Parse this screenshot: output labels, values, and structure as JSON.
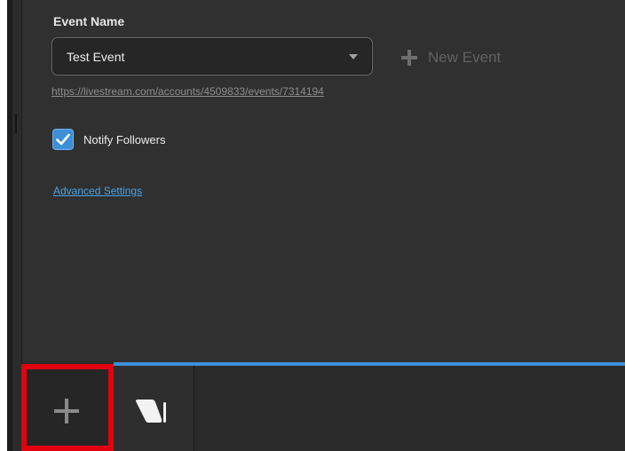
{
  "event": {
    "label": "Event Name",
    "selected_event": "Test Event",
    "new_event_label": "New Event",
    "url": "https://livestream.com/accounts/4509833/events/7314194"
  },
  "options": {
    "notify_followers_label": "Notify Followers",
    "notify_followers_checked": true,
    "advanced_settings_label": "Advanced Settings"
  },
  "bottom_tabs": {
    "add_icon": "plus-icon",
    "studio_icon": "livestream-logo-icon"
  },
  "colors": {
    "panel_bg": "#303030",
    "accent_blue": "#3d8fd8",
    "link_blue": "#4aa3e6",
    "highlight_red": "#e3000f"
  }
}
